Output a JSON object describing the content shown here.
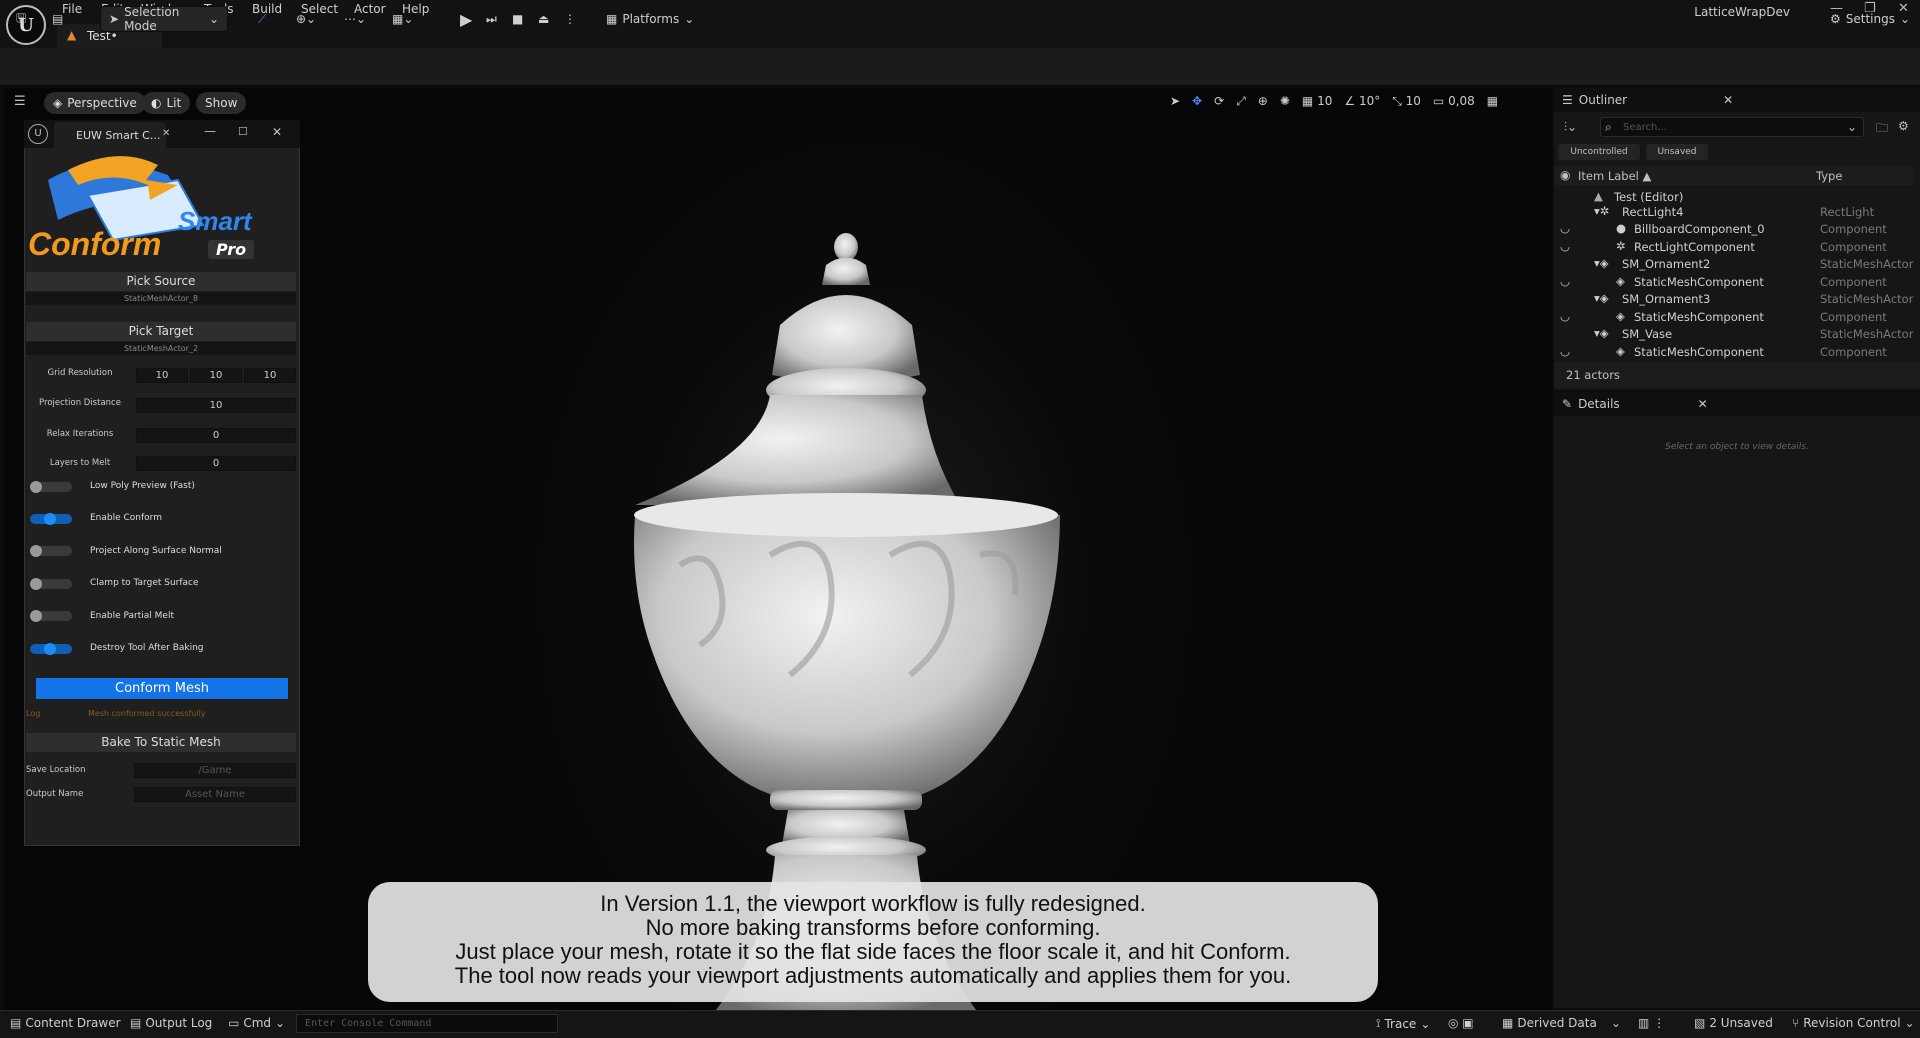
{
  "menus": [
    "File",
    "Edit",
    "Window",
    "Tools",
    "Build",
    "Select",
    "Actor",
    "Help"
  ],
  "project_name": "LatticeWrapDev",
  "doc_tab": "Test•",
  "toolbar": {
    "mode": "Selection Mode",
    "platforms": "Platforms",
    "settings": "Settings"
  },
  "viewport_bar": {
    "perspective": "Perspective",
    "lit": "Lit",
    "show": "Show",
    "grid": "10",
    "rot": "10°",
    "scale": "10",
    "cam": "0,08"
  },
  "euw": {
    "tab": "EUW Smart C...",
    "logo_top": "Smart",
    "logo_mid": "Conform",
    "logo_pro": "Pro",
    "pick_source": "Pick Source",
    "source_actor": "StaticMeshActor_8",
    "pick_target": "Pick Target",
    "target_actor": "StaticMeshActor_2",
    "grid_label": "Grid Resolution",
    "grid": [
      "10",
      "10",
      "10"
    ],
    "proj_label": "Projection Distance",
    "proj": "10",
    "relax_label": "Relax Iterations",
    "relax": "0",
    "layers_label": "Layers to Melt",
    "layers": "0",
    "toggles": [
      {
        "label": "Low Poly Preview (Fast)",
        "state": "OFF"
      },
      {
        "label": "Enable Conform",
        "state": "ON"
      },
      {
        "label": "Project Along Surface Normal",
        "state": "OFF"
      },
      {
        "label": "Clamp to Target Surface",
        "state": "OFF"
      },
      {
        "label": "Enable Partial Melt",
        "state": "OFF"
      },
      {
        "label": "Destroy Tool After Baking",
        "state": "ON"
      }
    ],
    "conform_button": "Conform Mesh",
    "log_label": "Log",
    "log_msg": "Mesh conformed successfully",
    "bake": "Bake To Static Mesh",
    "save_label": "Save Location",
    "save_ph": "/Game",
    "output_label": "Output Name",
    "output_ph": "Asset Name"
  },
  "outliner": {
    "title": "Outliner",
    "search_ph": "Search...",
    "chip1": "Uncontrolled",
    "chip2": "Unsaved",
    "col_label": "Item Label ▲",
    "col_type": "Type",
    "rows": [
      {
        "label": "Test (Editor)",
        "type": ""
      },
      {
        "label": "RectLight4",
        "type": "RectLight"
      },
      {
        "label": "BillboardComponent_0",
        "type": "Component"
      },
      {
        "label": "RectLightComponent",
        "type": "Component"
      },
      {
        "label": "SM_Ornament2",
        "type": "StaticMeshActor"
      },
      {
        "label": "StaticMeshComponent",
        "type": "Component"
      },
      {
        "label": "SM_Ornament3",
        "type": "StaticMeshActor"
      },
      {
        "label": "StaticMeshComponent",
        "type": "Component"
      },
      {
        "label": "SM_Vase",
        "type": "StaticMeshActor"
      },
      {
        "label": "StaticMeshComponent",
        "type": "Component"
      }
    ],
    "count": "21 actors"
  },
  "details": {
    "title": "Details",
    "empty": "Select an object to view details."
  },
  "caption": [
    "In Version 1.1, the viewport workflow is fully redesigned.",
    "No more baking transforms before conforming.",
    "Just place your mesh, rotate it so the flat side faces the floor scale it, and hit Conform.",
    "The tool now reads your viewport adjustments automatically and applies them for you."
  ],
  "status": {
    "content_drawer": "Content Drawer",
    "output_log": "Output Log",
    "cmd": "Cmd",
    "console_ph": "Enter Console Command",
    "trace": "Trace",
    "derived": "Derived Data",
    "unsaved": "2 Unsaved",
    "revision": "Revision Control"
  },
  "colors": {
    "accent": "#1473e6",
    "bg": "#0b0b0b",
    "panel": "#1f1f1f"
  }
}
